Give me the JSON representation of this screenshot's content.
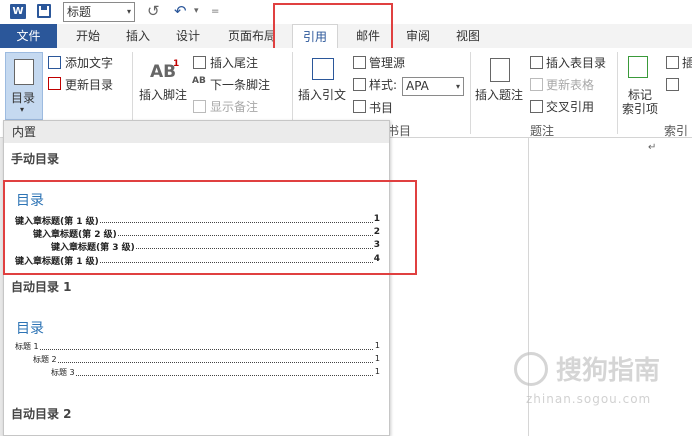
{
  "qat": {
    "logo_letter": "W",
    "style_value": "标题",
    "undo_glyph": "↺",
    "redo_glyph": "↶",
    "customize_glyph": "=",
    "dropdown_glyph": "▾"
  },
  "tabs": [
    {
      "label": "文件"
    },
    {
      "label": "开始"
    },
    {
      "label": "插入"
    },
    {
      "label": "设计"
    },
    {
      "label": "页面布局"
    },
    {
      "label": "引用"
    },
    {
      "label": "邮件"
    },
    {
      "label": "审阅"
    },
    {
      "label": "视图"
    }
  ],
  "ribbon": {
    "toc_label": "目录",
    "add_text": "添加文字",
    "update_toc": "更新目录",
    "insert_footnote": "插入脚注",
    "insert_endnote": "插入尾注",
    "next_footnote": "下一条脚注",
    "show_notes": "显示备注",
    "insert_citation": "插入引文",
    "manage_sources": "管理源",
    "style_label": "样式:",
    "style_value": "APA",
    "bibliography": "书目",
    "bibliography_group": "书目",
    "insert_caption": "插入题注",
    "insert_table_of_figures": "插入表目录",
    "update_table": "更新表格",
    "cross_reference": "交叉引用",
    "captions_group": "题注",
    "mark_entry_1": "标记",
    "mark_entry_2": "索引项",
    "index_group": "索引",
    "insert_index_partial": "插",
    "ab_text": "AB",
    "ab_sup": "1",
    "ab_next": "AB",
    "ab_next_sup": "1"
  },
  "colors": {
    "file_tab": "#2b579a",
    "accent": "#2b579a",
    "highlight_red": "#e04040",
    "toc_heading": "#2e74b5"
  },
  "dropdown": {
    "header": "内置",
    "manual_title": "手动目录",
    "manual_toc": {
      "heading": "目录",
      "lines": [
        {
          "label": "键入章标题(第 1 级)",
          "num": "1"
        },
        {
          "label": "键入章标题(第 2 级)",
          "num": "2"
        },
        {
          "label": "键入章标题(第 3 级)",
          "num": "3"
        },
        {
          "label": "键入章标题(第 1 级)",
          "num": "4"
        }
      ]
    },
    "auto1_title": "自动目录 1",
    "auto1_toc": {
      "heading": "目录",
      "lines": [
        {
          "label": "标题 1",
          "num": "1"
        },
        {
          "label": "标题 2",
          "num": "1"
        },
        {
          "label": "标题 3",
          "num": "1"
        }
      ]
    },
    "auto2_title": "自动目录 2"
  },
  "document": {
    "paragraph_mark": "↵"
  },
  "watermark": {
    "text": "搜狗指南",
    "sub": "zhinan.sogou.com"
  }
}
